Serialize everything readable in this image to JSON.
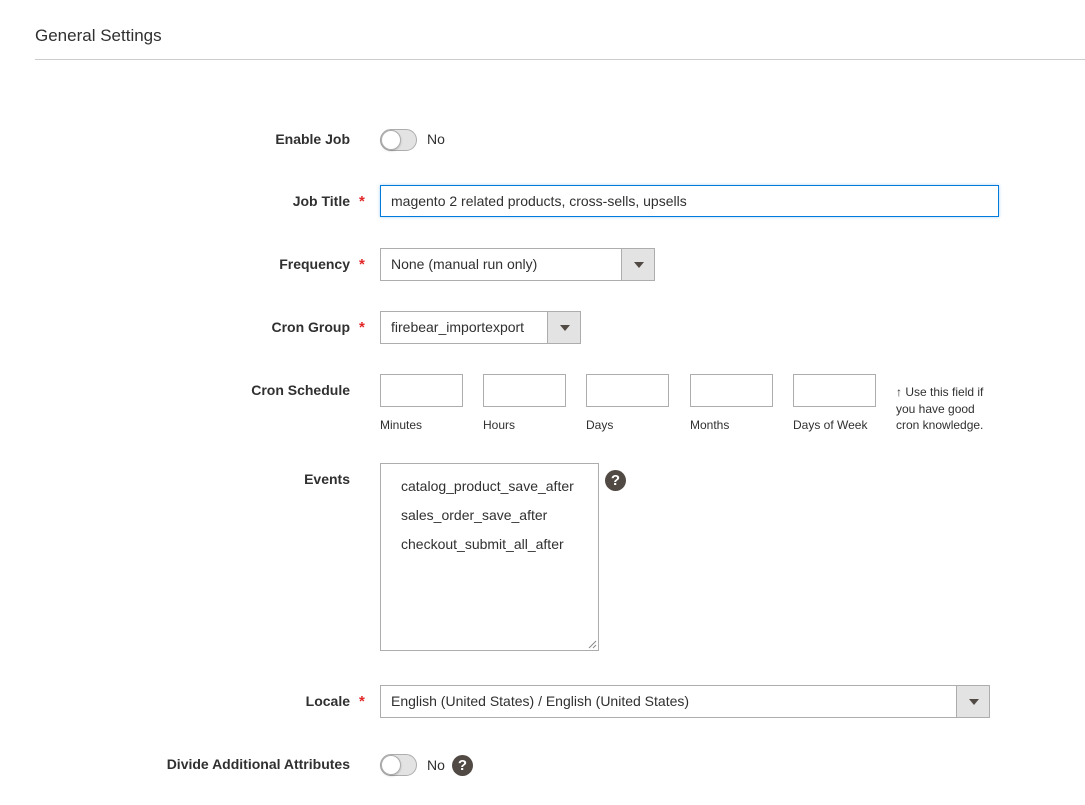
{
  "section": {
    "title": "General Settings"
  },
  "enable_job": {
    "label": "Enable Job",
    "value": "No",
    "checked": false
  },
  "job_title": {
    "label": "Job Title",
    "required": "*",
    "value": "magento 2 related products, cross-sells, upsells"
  },
  "frequency": {
    "label": "Frequency",
    "required": "*",
    "value": "None (manual run only)"
  },
  "cron_group": {
    "label": "Cron Group",
    "required": "*",
    "value": "firebear_importexport"
  },
  "cron_schedule": {
    "label": "Cron Schedule",
    "fields": [
      {
        "label": "Minutes",
        "value": ""
      },
      {
        "label": "Hours",
        "value": ""
      },
      {
        "label": "Days",
        "value": ""
      },
      {
        "label": "Months",
        "value": ""
      },
      {
        "label": "Days of Week",
        "value": ""
      }
    ],
    "note": "↑ Use this field if you have good cron knowledge."
  },
  "events": {
    "label": "Events",
    "options": [
      "catalog_product_save_after",
      "sales_order_save_after",
      "checkout_submit_all_after"
    ],
    "help": "?"
  },
  "locale": {
    "label": "Locale",
    "required": "*",
    "value": "English (United States) / English (United States)"
  },
  "divide_attributes": {
    "label": "Divide Additional Attributes",
    "value": "No",
    "checked": false,
    "help": "?"
  },
  "colors": {
    "accent": "#007bdb",
    "required": "#e22626",
    "text": "#303030",
    "border": "#adadad",
    "help_bg": "#514943"
  }
}
